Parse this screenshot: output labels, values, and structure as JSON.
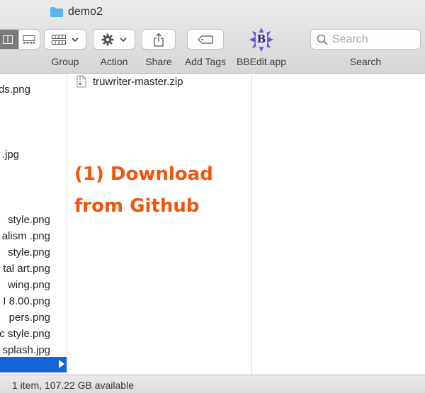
{
  "window": {
    "title": "demo2"
  },
  "toolbar": {
    "group_label": "Group",
    "action_label": "Action",
    "share_label": "Share",
    "add_tags_label": "Add Tags",
    "app_label": "BBEdit.app",
    "search_label": "Search",
    "search_placeholder": "Search",
    "app_icon_letter": "B"
  },
  "column1": {
    "items": [
      "ds.png",
      ".jpg",
      "style.png",
      "alism .png",
      "style.png",
      "tal art.png",
      "wing.png",
      "I 8.00.png",
      "pers.png",
      "c style.png",
      "splash.jpg"
    ]
  },
  "column2": {
    "files": [
      {
        "name": "truwriter-master.zip",
        "icon": "zip-file-icon"
      }
    ]
  },
  "annotation": {
    "line1": "(1) Download",
    "line2": "from Github"
  },
  "status": {
    "text": "1 item, 107.22 GB available"
  },
  "colors": {
    "selection": "#1464d8",
    "annotation": "#f2540c",
    "folder": "#5cb7f0"
  }
}
